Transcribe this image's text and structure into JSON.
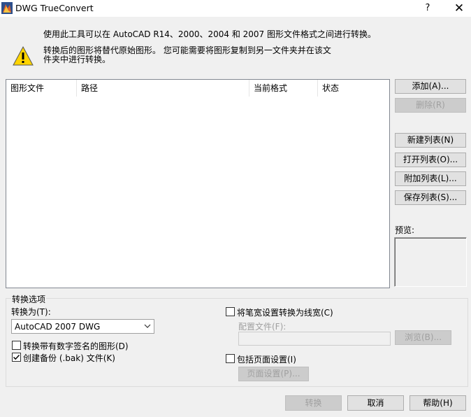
{
  "window": {
    "title": "DWG TrueConvert",
    "help_glyph": "?",
    "close_glyph": "✕"
  },
  "info": {
    "line1": "使用此工具可以在 AutoCAD R14、2000、2004 和 2007 图形文件格式之间进行转换。",
    "warning_line1": "转换后的图形将替代原始图形。 您可能需要将图形复制到另一文件夹并在该文",
    "warning_line2": "件夹中进行转换。"
  },
  "file_list": {
    "columns": [
      "图形文件",
      "路径",
      "当前格式",
      "状态"
    ],
    "rows": []
  },
  "side_buttons": {
    "add": "添加(A)...",
    "remove": "删除(R)",
    "new_list": "新建列表(N)",
    "open_list": "打开列表(O)...",
    "append_list": "附加列表(L)...",
    "save_list": "保存列表(S)..."
  },
  "preview": {
    "label": "预览:"
  },
  "options": {
    "group_title": "转换选项",
    "convert_to_label": "转换为(T):",
    "convert_to_value": "AutoCAD 2007 DWG",
    "digital_sig_label": "转换带有数字签名的图形(D)",
    "digital_sig_checked": false,
    "backup_label": "创建备份 (.bak) 文件(K)",
    "backup_checked": true,
    "pen_width_label": "将笔宽设置转换为线宽(C)",
    "pen_width_checked": false,
    "config_file_label": "配置文件(F):",
    "config_file_value": "",
    "browse_label": "浏览(B)...",
    "page_setup_check_label": "包括页面设置(I)",
    "page_setup_checked": false,
    "page_setup_button": "页面设置(P)..."
  },
  "footer": {
    "convert": "转换",
    "cancel": "取消",
    "help": "帮助(H)"
  }
}
